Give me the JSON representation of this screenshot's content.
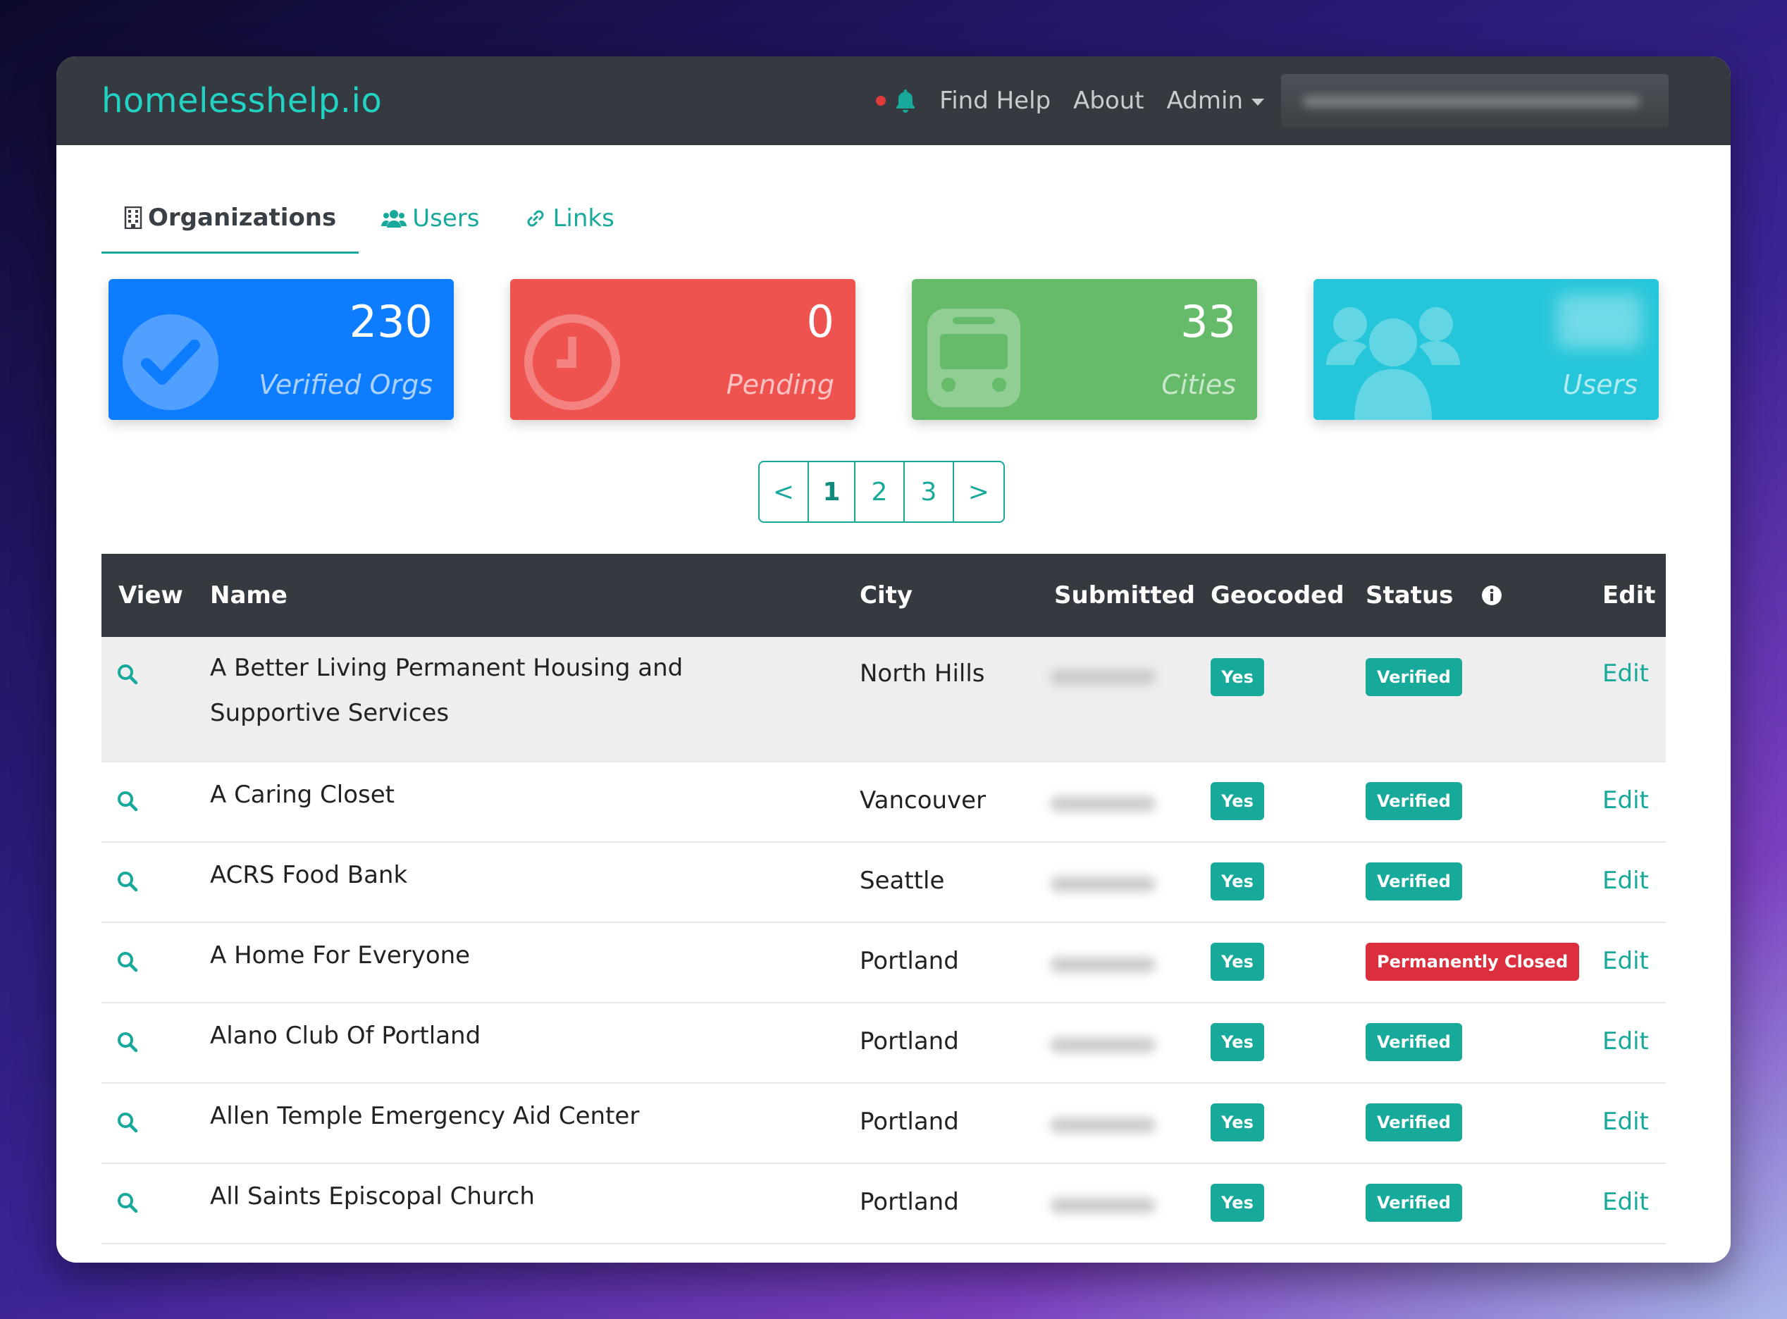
{
  "navbar": {
    "brand": "homelesshelp.io",
    "links": [
      "Find Help",
      "About",
      "Admin"
    ]
  },
  "tabs": [
    {
      "label": "Organizations",
      "active": true,
      "icon": "building-icon"
    },
    {
      "label": "Users",
      "active": false,
      "icon": "users-icon"
    },
    {
      "label": "Links",
      "active": false,
      "icon": "link-icon"
    }
  ],
  "cards": [
    {
      "value": "230",
      "label": "Verified Orgs",
      "color": "#0d7cff",
      "icon": "check-circle-icon"
    },
    {
      "value": "0",
      "label": "Pending",
      "color": "#ef5350",
      "icon": "clock-icon"
    },
    {
      "value": "33",
      "label": "Cities",
      "color": "#66bb6a",
      "icon": "bus-icon"
    },
    {
      "value": "",
      "label": "Users",
      "color": "#26c6da",
      "icon": "users-icon"
    }
  ],
  "pagination": {
    "prev": "<",
    "pages": [
      "1",
      "2",
      "3"
    ],
    "next": ">",
    "current": "1"
  },
  "table": {
    "headers": {
      "view": "View",
      "name": "Name",
      "city": "City",
      "submitted": "Submitted",
      "geocoded": "Geocoded",
      "status": "Status",
      "edit": "Edit"
    },
    "rows": [
      {
        "name": "A Better Living Permanent Housing and Supportive Services",
        "city": "North Hills",
        "geocoded": "Yes",
        "status": "Verified",
        "edit": "Edit"
      },
      {
        "name": "A Caring Closet",
        "city": "Vancouver",
        "geocoded": "Yes",
        "status": "Verified",
        "edit": "Edit"
      },
      {
        "name": "ACRS Food Bank",
        "city": "Seattle",
        "geocoded": "Yes",
        "status": "Verified",
        "edit": "Edit"
      },
      {
        "name": "A Home For Everyone",
        "city": "Portland",
        "geocoded": "Yes",
        "status": "Permanently Closed",
        "edit": "Edit"
      },
      {
        "name": "Alano Club Of Portland",
        "city": "Portland",
        "geocoded": "Yes",
        "status": "Verified",
        "edit": "Edit"
      },
      {
        "name": "Allen Temple Emergency Aid Center",
        "city": "Portland",
        "geocoded": "Yes",
        "status": "Verified",
        "edit": "Edit"
      },
      {
        "name": "All Saints Episcopal Church",
        "city": "Portland",
        "geocoded": "Yes",
        "status": "Verified",
        "edit": "Edit"
      }
    ]
  }
}
